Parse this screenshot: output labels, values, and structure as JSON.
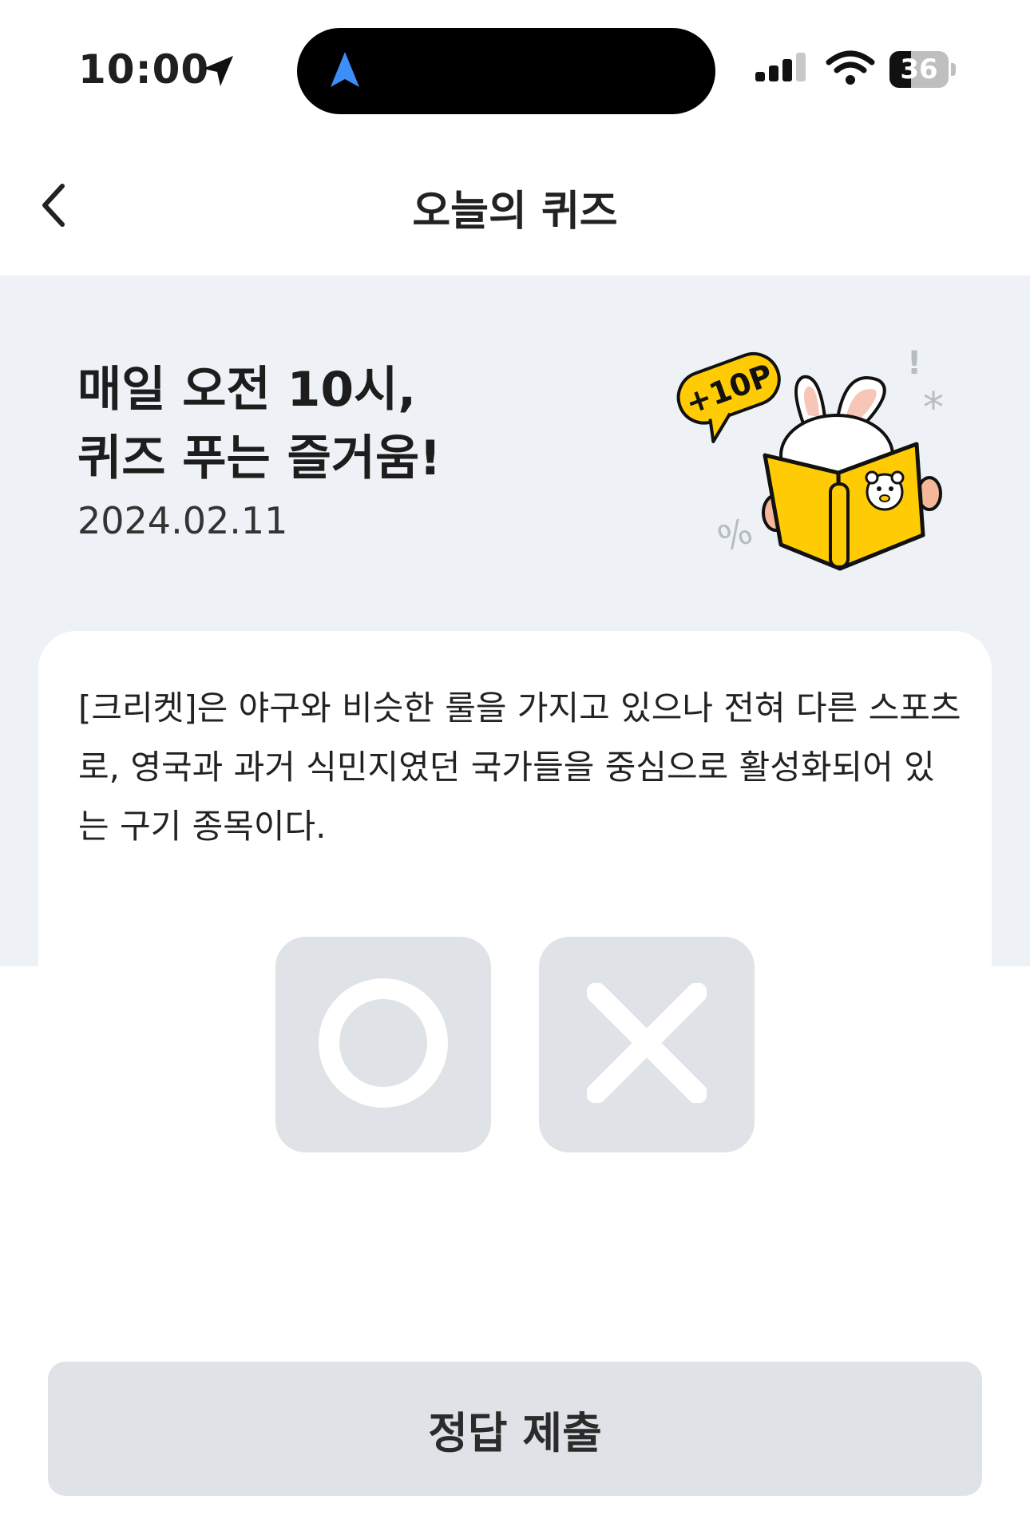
{
  "status_bar": {
    "time": "10:00",
    "battery_percent": 36,
    "battery_label": "36",
    "icons": [
      "location-arrow-icon",
      "navigation-icon",
      "cellular-signal-icon",
      "wifi-icon",
      "battery-icon"
    ]
  },
  "nav": {
    "title": "오늘의 퀴즈",
    "back_icon": "chevron-left-icon"
  },
  "hero": {
    "title_lines": [
      "매일 오전 10시,",
      "퀴즈 푸는 즐거움!"
    ],
    "date": "2024.02.11",
    "badge_text": "+10P",
    "mascot_icon": "rabbit-reading-book-illustration"
  },
  "quiz": {
    "question": "[크리켓]은 야구와 비슷한 룰을 가지고 있으나 전혀 다른 스포츠로, 영국과 과거 식민지였던 국가들을 중심으로 활성화되어 있는 구기 종목이다.",
    "options": [
      {
        "icon": "circle-o-icon"
      },
      {
        "icon": "x-mark-icon"
      }
    ]
  },
  "submit": {
    "label": "정답 제출"
  },
  "colors": {
    "hero_bg": "#eef1f5",
    "button_bg": "#dfe2e6",
    "accent_yellow": "#ffcb05",
    "nav_blue": "#3d8ef7"
  }
}
